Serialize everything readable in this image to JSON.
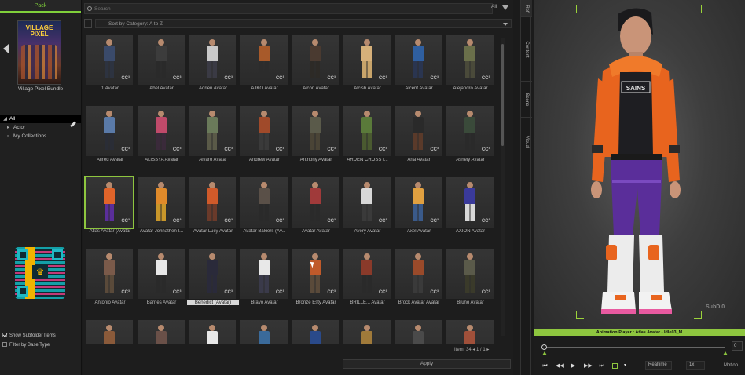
{
  "left_panel": {
    "tab_label": "Pack",
    "pack_title_art": "VILLAGE PIXEL",
    "pack_name": "Village Pixel Bundle",
    "tree": [
      {
        "label": "All",
        "selected": true
      },
      {
        "label": "Actor",
        "selected": false
      },
      {
        "label": "My Collections",
        "selected": false
      }
    ],
    "show_subfolder_items": "Show Subfolder Items",
    "filter_by_base_type": "Filter by Base Type"
  },
  "content": {
    "search_placeholder": "Search",
    "search_scope": "All",
    "sort_label": "Sort by Category: A to Z",
    "items": [
      {
        "label": "1 Avatar",
        "shirt": "#3a4a6a",
        "pants": "#2d3340",
        "cc": true
      },
      {
        "label": "Abel Avatar",
        "shirt": "#3c3c3c",
        "pants": "#2a2a2a",
        "cc": true
      },
      {
        "label": "Adrien Avatar",
        "shirt": "#c9c9c9",
        "pants": "#3a3a44",
        "cc": true
      },
      {
        "label": "AJKO Avatar",
        "shirt": "#a85a2a",
        "pants": "#2c2c2c",
        "cc": true
      },
      {
        "label": "Alcon Avatar",
        "shirt": "#4a3a30",
        "pants": "#2d2a26",
        "cc": true
      },
      {
        "label": "Alcish Avatar",
        "shirt": "#d6b07a",
        "pants": "#c8a46a",
        "cc": true
      },
      {
        "label": "Alcent Avatar",
        "shirt": "#2f5fa0",
        "pants": "#2a3550",
        "cc": true
      },
      {
        "label": "Alejandro Avatar",
        "shirt": "#6a6f4a",
        "pants": "#4a4a3a",
        "cc": true
      },
      {
        "label": "Alfred Avatar",
        "shirt": "#5a7aa8",
        "pants": "#2a2d36",
        "cc": true
      },
      {
        "label": "ALISSYA Avatar",
        "shirt": "#c04a6a",
        "pants": "#3a2a3a",
        "cc": true
      },
      {
        "label": "Alvaro Avatar",
        "shirt": "#6a7a5a",
        "pants": "#5a5a48",
        "cc": true
      },
      {
        "label": "Andrew Avatar",
        "shirt": "#a04a2a",
        "pants": "#3a3a3a",
        "cc": true
      },
      {
        "label": "Anthony Avatar",
        "shirt": "#5a5a4a",
        "pants": "#4a4436",
        "cc": true
      },
      {
        "label": "ARDEN CROSS I...",
        "shirt": "#5a7a3a",
        "pants": "#4a5a30",
        "cc": true
      },
      {
        "label": "Aria Avatar",
        "shirt": "#2a2a2a",
        "pants": "#5a3a2a",
        "cc": true
      },
      {
        "label": "Ashely Avatar",
        "shirt": "#3a4a3a",
        "pants": "#2a2a2a",
        "cc": true
      },
      {
        "label": "Atlas Avatar (Avatar",
        "shirt": "#e0642a",
        "pants": "#5a2e9a",
        "cc": true,
        "selected": true
      },
      {
        "label": "Avatar Johnathen I...",
        "shirt": "#e08a2a",
        "pants": "#c8962a",
        "cc": true
      },
      {
        "label": "Avatar Lucy Avatar",
        "shirt": "#d05a2a",
        "pants": "#6a3a2a",
        "cc": true
      },
      {
        "label": "Avatar Bakiers (Av...",
        "shirt": "#5a5048",
        "pants": "#2a2a2a",
        "cc": true
      },
      {
        "label": "Avatar Avatar",
        "shirt": "#a03a3a",
        "pants": "#2a2a2a",
        "cc": true
      },
      {
        "label": "Avery Avatar",
        "shirt": "#d8d8d8",
        "pants": "#3a3a3a",
        "cc": true
      },
      {
        "label": "Axel Avatar",
        "shirt": "#e0a040",
        "pants": "#3a5a8a",
        "cc": true
      },
      {
        "label": "AXION Avatar",
        "shirt": "#3a3a9a",
        "pants": "#d8d8d8",
        "cc": true
      },
      {
        "label": "Antonio Avatar",
        "shirt": "#7a5a4a",
        "pants": "#5a4a3a",
        "cc": true
      },
      {
        "label": "Barnes Avatar",
        "shirt": "#e8e8e8",
        "pants": "#2a2a2a",
        "cc": true
      },
      {
        "label": "Benedict (Avatar)",
        "shirt": "#2a2a3a",
        "pants": "#2a2a3a",
        "cc": true,
        "highlight": true
      },
      {
        "label": "Bravo Avatar",
        "shirt": "#e8e8e8",
        "pants": "#3a3a4a",
        "cc": true
      },
      {
        "label": "Bronze Esty Avatar",
        "shirt": "#c05a2a",
        "pants": "#5a4a3a",
        "cc": true
      },
      {
        "label": "BRILLE... Avatar",
        "shirt": "#8a3a2a",
        "pants": "#2a2a2a",
        "cc": true
      },
      {
        "label": "Brock Avatar Avatar",
        "shirt": "#9a4a2a",
        "pants": "#3a3a3a",
        "cc": true
      },
      {
        "label": "Bruno Avatar",
        "shirt": "#5a5a4a",
        "pants": "#3a3a2a",
        "cc": true
      },
      {
        "label": "",
        "shirt": "#8a5a3a",
        "pants": "#3a3a3a",
        "cc": false
      },
      {
        "label": "",
        "shirt": "#6a5048",
        "pants": "#2a2a2a",
        "cc": false
      },
      {
        "label": "",
        "shirt": "#e8e8e8",
        "pants": "#2a2a2a",
        "cc": false
      },
      {
        "label": "",
        "shirt": "#3a6a9a",
        "pants": "#2a2a3a",
        "cc": false
      },
      {
        "label": "",
        "shirt": "#2a4a8a",
        "pants": "#2a2a3a",
        "cc": false
      },
      {
        "label": "",
        "shirt": "#a07a3a",
        "pants": "#3a3a2a",
        "cc": false
      },
      {
        "label": "",
        "shirt": "#4a4a4a",
        "pants": "#2a2a2a",
        "cc": false
      },
      {
        "label": "",
        "shirt": "#a0503a",
        "pants": "#2a2a2a",
        "cc": false
      }
    ],
    "cc_badge": "CC³",
    "page_info": "Item: 34  ◂ 1 / 1 ▸",
    "apply_label": "Apply"
  },
  "vertical_tabs": [
    {
      "label": "Ref",
      "active": true
    },
    {
      "label": "Content",
      "active": false
    },
    {
      "label": "Scene",
      "active": false
    },
    {
      "label": "Visual",
      "active": false
    }
  ],
  "viewport": {
    "shirt_logo": "SAINS",
    "subd_label": "SubD 0"
  },
  "animation_player": {
    "title": "Animation Player : Atlas Avatar - Idle03_M",
    "frame_value": "0",
    "realtime_label": "Realtime",
    "speed_label": "1x",
    "motion_label": "Motion"
  },
  "colors": {
    "accent_green": "#8ec63f",
    "jacket_orange": "#e8641e",
    "pants_purple": "#5a2e9a"
  }
}
